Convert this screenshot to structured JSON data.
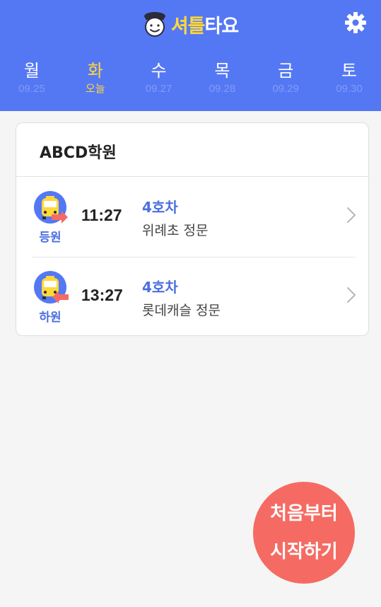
{
  "header": {
    "brand_part1": "셔틀",
    "brand_part2": "타요",
    "colors": {
      "background": "#5478f4",
      "accent": "#ffd83a"
    },
    "icons": {
      "logo": "driver-mascot-icon",
      "settings": "gear-icon"
    }
  },
  "days": [
    {
      "name": "월",
      "sub": "09.25",
      "active": false
    },
    {
      "name": "화",
      "sub": "오늘",
      "active": true
    },
    {
      "name": "수",
      "sub": "09.27",
      "active": false
    },
    {
      "name": "목",
      "sub": "09.28",
      "active": false
    },
    {
      "name": "금",
      "sub": "09.29",
      "active": false
    },
    {
      "name": "토",
      "sub": "09.30",
      "active": false
    }
  ],
  "card": {
    "title": "ABCD학원",
    "rows": [
      {
        "type_label": "등원",
        "time": "11:27",
        "vehicle": "4호차",
        "stop": "위례초 정문",
        "icon": "bus-arrow-right-icon"
      },
      {
        "type_label": "하원",
        "time": "13:27",
        "vehicle": "4호차",
        "stop": "롯데캐슬 정문",
        "icon": "bus-arrow-left-icon"
      }
    ]
  },
  "fab": {
    "line1": "처음부터",
    "line2": "시작하기",
    "color": "#f56b63"
  }
}
